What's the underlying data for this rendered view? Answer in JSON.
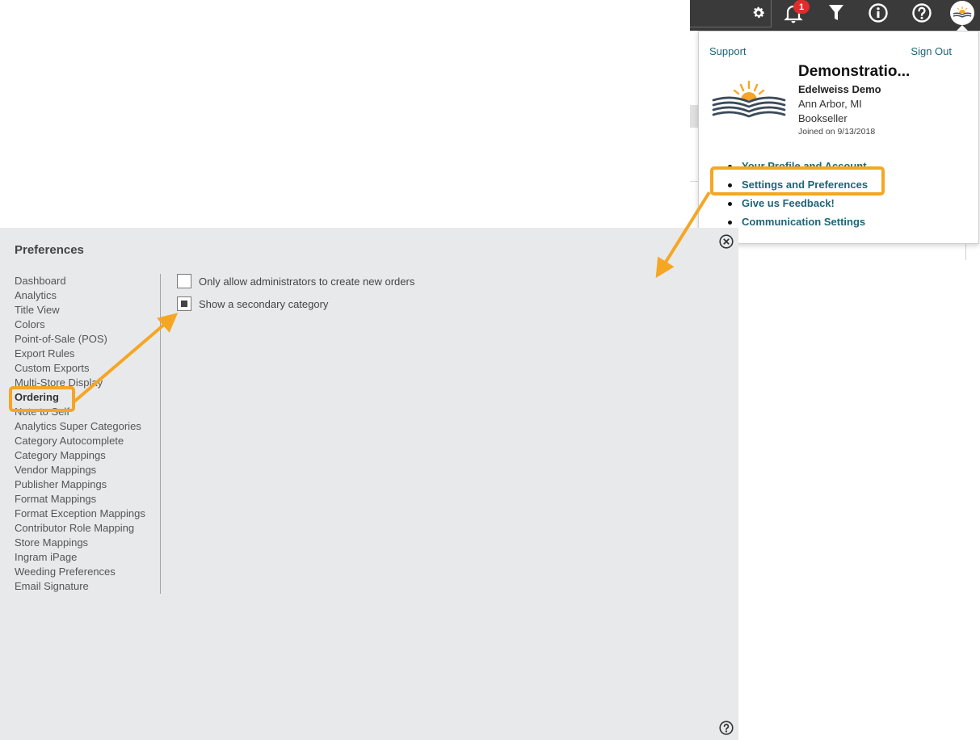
{
  "toolbar": {
    "notification_count": "1",
    "icons": [
      "gear-icon",
      "bell-icon",
      "filter-icon",
      "info-icon",
      "help-icon",
      "avatar"
    ]
  },
  "account_dropdown": {
    "support_label": "Support",
    "signout_label": "Sign Out",
    "org_name": "Demonstratio...",
    "org_subtitle": "Edelweiss Demo",
    "location": "Ann Arbor, MI",
    "account_type": "Bookseller",
    "joined": "Joined on 9/13/2018",
    "menu": [
      {
        "label": "Your Profile and Account"
      },
      {
        "label": "Settings and Preferences"
      },
      {
        "label": "Give us Feedback!"
      },
      {
        "label": "Communication Settings"
      }
    ]
  },
  "preferences": {
    "title": "Preferences",
    "nav": [
      {
        "label": "Dashboard"
      },
      {
        "label": "Analytics"
      },
      {
        "label": "Title View"
      },
      {
        "label": "Colors"
      },
      {
        "label": "Point-of-Sale (POS)"
      },
      {
        "label": "Export Rules"
      },
      {
        "label": "Custom Exports"
      },
      {
        "label": "Multi-Store Display"
      },
      {
        "label": "Ordering"
      },
      {
        "label": "Note to Self"
      },
      {
        "label": "Analytics Super Categories"
      },
      {
        "label": "Category Autocomplete"
      },
      {
        "label": "Category Mappings"
      },
      {
        "label": "Vendor Mappings"
      },
      {
        "label": "Publisher Mappings"
      },
      {
        "label": "Format Mappings"
      },
      {
        "label": "Format Exception Mappings"
      },
      {
        "label": "Contributor Role Mapping"
      },
      {
        "label": "Store Mappings"
      },
      {
        "label": "Ingram iPage"
      },
      {
        "label": "Weeding Preferences"
      },
      {
        "label": "Email Signature"
      }
    ],
    "active_nav": "Ordering",
    "options": [
      {
        "label": "Only allow administrators to create new orders",
        "checked": false
      },
      {
        "label": "Show a secondary category",
        "checked": true
      }
    ]
  },
  "colors": {
    "toolbar_bg": "#3a3a3a",
    "link": "#1f6478",
    "badge": "#e22b2b",
    "annotation": "#f5a623",
    "panel_bg": "#e8e9eb"
  }
}
